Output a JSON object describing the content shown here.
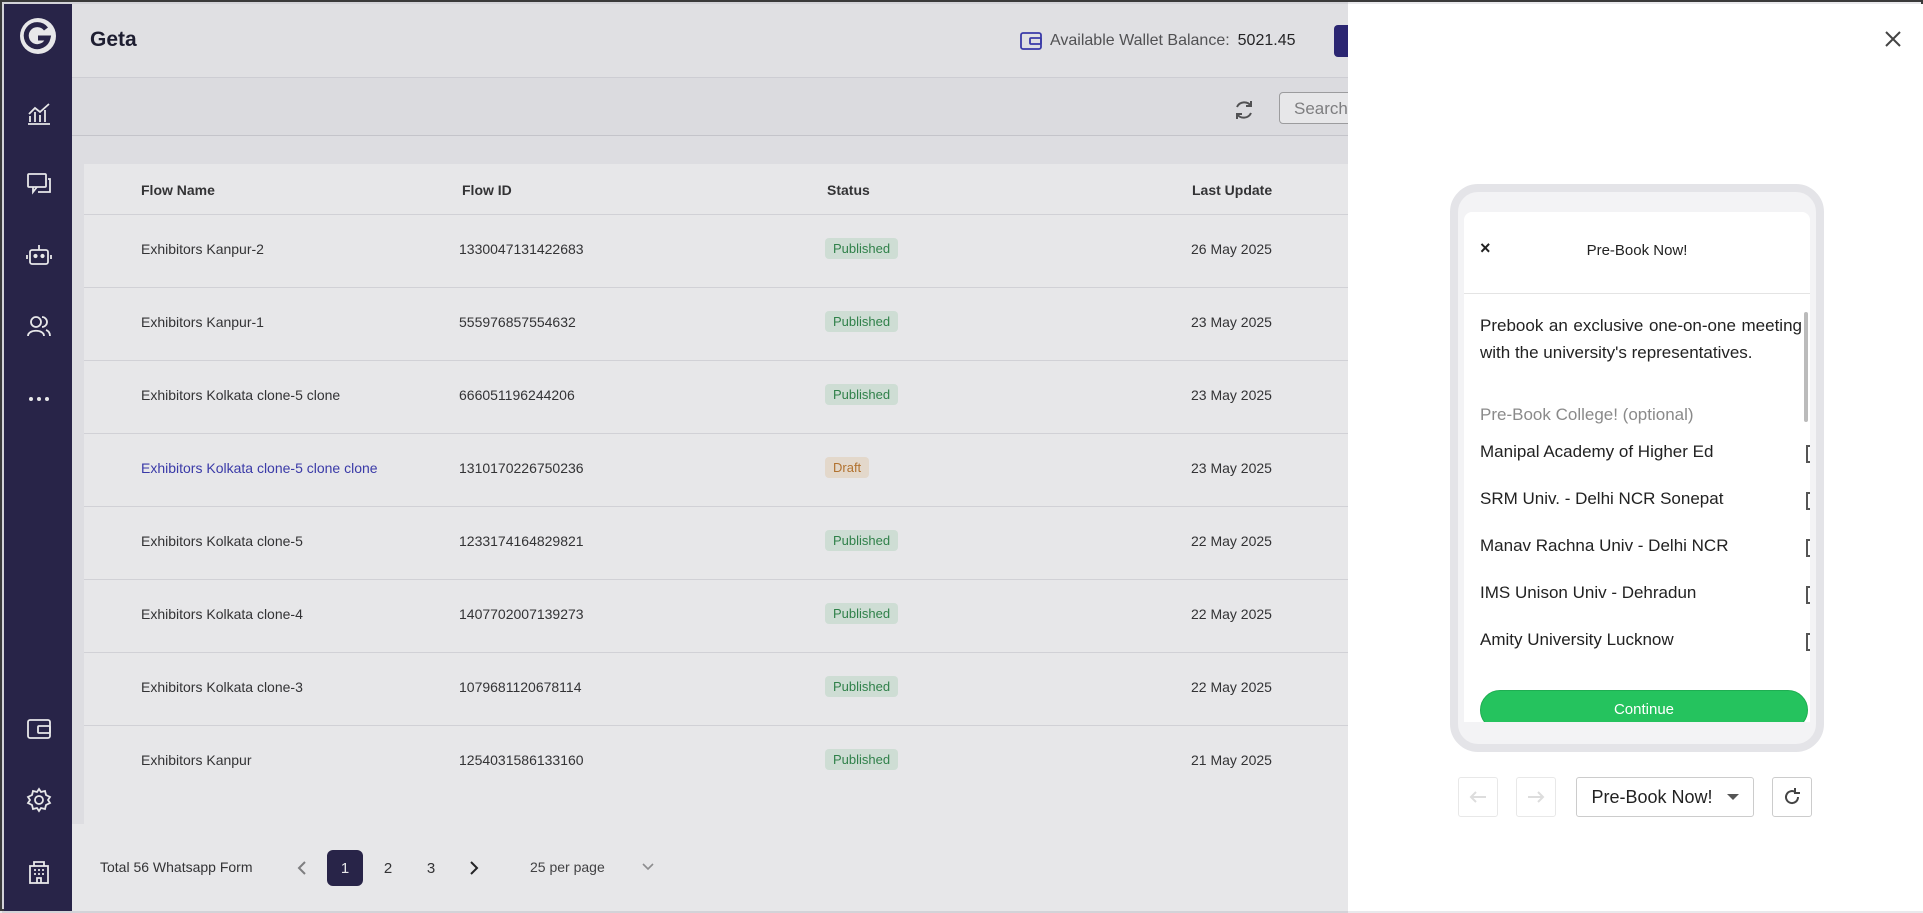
{
  "app": {
    "title": "Geta"
  },
  "wallet": {
    "label": "Available Wallet Balance:",
    "amount": "5021.45"
  },
  "toolbar": {
    "search_placeholder": "Search"
  },
  "table": {
    "columns": [
      "Flow Name",
      "Flow ID",
      "Status",
      "Last Update"
    ],
    "rows": [
      {
        "name": "Exhibitors Kanpur-2",
        "id": "1330047131422683",
        "status": "Published",
        "updated": "26 May 2025"
      },
      {
        "name": "Exhibitors Kanpur-1",
        "id": "555976857554632",
        "status": "Published",
        "updated": "23 May 2025"
      },
      {
        "name": "Exhibitors Kolkata clone-5 clone",
        "id": "666051196244206",
        "status": "Published",
        "updated": "23 May 2025"
      },
      {
        "name": "Exhibitors Kolkata clone-5 clone clone",
        "id": "1310170226750236",
        "status": "Draft",
        "updated": "23 May 2025"
      },
      {
        "name": "Exhibitors Kolkata clone-5",
        "id": "1233174164829821",
        "status": "Published",
        "updated": "22 May 2025"
      },
      {
        "name": "Exhibitors Kolkata clone-4",
        "id": "1407702007139273",
        "status": "Published",
        "updated": "22 May 2025"
      },
      {
        "name": "Exhibitors Kolkata clone-3",
        "id": "1079681120678114",
        "status": "Published",
        "updated": "22 May 2025"
      },
      {
        "name": "Exhibitors Kanpur",
        "id": "1254031586133160",
        "status": "Published",
        "updated": "21 May 2025"
      }
    ]
  },
  "pagination": {
    "total_label": "Total 56 Whatsapp Form",
    "pages": [
      "1",
      "2",
      "3"
    ],
    "current": "1",
    "per_page": "25 per page"
  },
  "preview": {
    "screen_title": "Pre-Book Now!",
    "close_glyph": "×",
    "description": "Prebook an exclusive one-on-one meeting with the university's representatives.",
    "options_label": "Pre-Book College! (optional)",
    "options": [
      "Manipal Academy of Higher Ed",
      "SRM Univ. - Delhi NCR Sonepat",
      "Manav Rachna Univ - Delhi NCR",
      "IMS Unison Univ - Dehradun",
      "Amity University Lucknow"
    ],
    "continue_label": "Continue",
    "screen_select_value": "Pre-Book Now!"
  },
  "colors": {
    "sidebar": "#262148",
    "accent": "#262148",
    "continue": "#25c35e",
    "published": "#2f8b4a",
    "draft": "#c27a2c"
  },
  "icons": [
    "logo-icon",
    "analytics-icon",
    "chat-icon",
    "bot-icon",
    "contacts-icon",
    "more-icon",
    "wallet-icon",
    "settings-icon",
    "building-icon",
    "refresh-icon",
    "close-icon",
    "back-arrow-icon",
    "forward-arrow-icon",
    "reload-icon"
  ]
}
